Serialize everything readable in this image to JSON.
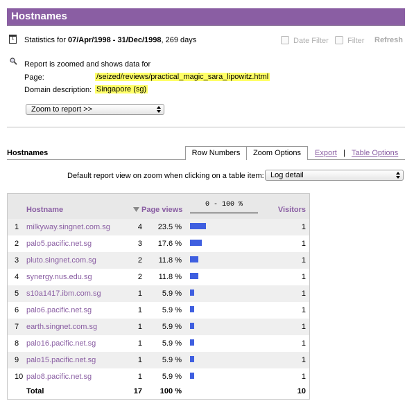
{
  "title": "Hostnames",
  "stats": {
    "prefix": "Statistics for ",
    "range": "07/Apr/1998 - 31/Dec/1998",
    "suffix": ", 269 days",
    "date_filter_label": "Date Filter",
    "filter_label": "Filter",
    "refresh_label": "Refresh"
  },
  "zoom_info": {
    "intro": "Report is zoomed and shows data for",
    "page_label": "Page:",
    "page_value": "/seized/reviews/practical_magic_sara_lipowitz.html",
    "domain_label": "Domain description:",
    "domain_value": "Singapore (sg)",
    "zoom_select": "Zoom to report >>"
  },
  "section": {
    "title": "Hostnames",
    "tabs": [
      "Row Numbers",
      "Zoom Options"
    ],
    "export_link": "Export",
    "separator": "|",
    "table_options_link": "Table Options",
    "default_view_label": "Default report view on zoom when clicking on a table item:",
    "default_view_value": "Log detail"
  },
  "table": {
    "columns": {
      "hostname": "Hostname",
      "page_views": "Page views",
      "scale": "0 - 100 %",
      "visitors": "Visitors"
    },
    "rows": [
      {
        "num": "1",
        "host": "milkyway.singnet.com.sg",
        "views": "4",
        "pct": "23.5 %",
        "fraction": 0.235,
        "visitors": "1"
      },
      {
        "num": "2",
        "host": "palo5.pacific.net.sg",
        "views": "3",
        "pct": "17.6 %",
        "fraction": 0.176,
        "visitors": "1"
      },
      {
        "num": "3",
        "host": "pluto.singnet.com.sg",
        "views": "2",
        "pct": "11.8 %",
        "fraction": 0.118,
        "visitors": "1"
      },
      {
        "num": "4",
        "host": "synergy.nus.edu.sg",
        "views": "2",
        "pct": "11.8 %",
        "fraction": 0.118,
        "visitors": "1"
      },
      {
        "num": "5",
        "host": "s10a1417.ibm.com.sg",
        "views": "1",
        "pct": "5.9 %",
        "fraction": 0.059,
        "visitors": "1"
      },
      {
        "num": "6",
        "host": "palo6.pacific.net.sg",
        "views": "1",
        "pct": "5.9 %",
        "fraction": 0.059,
        "visitors": "1"
      },
      {
        "num": "7",
        "host": "earth.singnet.com.sg",
        "views": "1",
        "pct": "5.9 %",
        "fraction": 0.059,
        "visitors": "1"
      },
      {
        "num": "8",
        "host": "palo16.pacific.net.sg",
        "views": "1",
        "pct": "5.9 %",
        "fraction": 0.059,
        "visitors": "1"
      },
      {
        "num": "9",
        "host": "palo15.pacific.net.sg",
        "views": "1",
        "pct": "5.9 %",
        "fraction": 0.059,
        "visitors": "1"
      },
      {
        "num": "10",
        "host": "palo8.pacific.net.sg",
        "views": "1",
        "pct": "5.9 %",
        "fraction": 0.059,
        "visitors": "1"
      }
    ],
    "total": {
      "label": "Total",
      "views": "17",
      "pct": "100 %",
      "visitors": "10"
    }
  },
  "colors": {
    "accent": "#8a5ea3",
    "bar": "#3f5fe0",
    "highlight": "#ffff66"
  }
}
